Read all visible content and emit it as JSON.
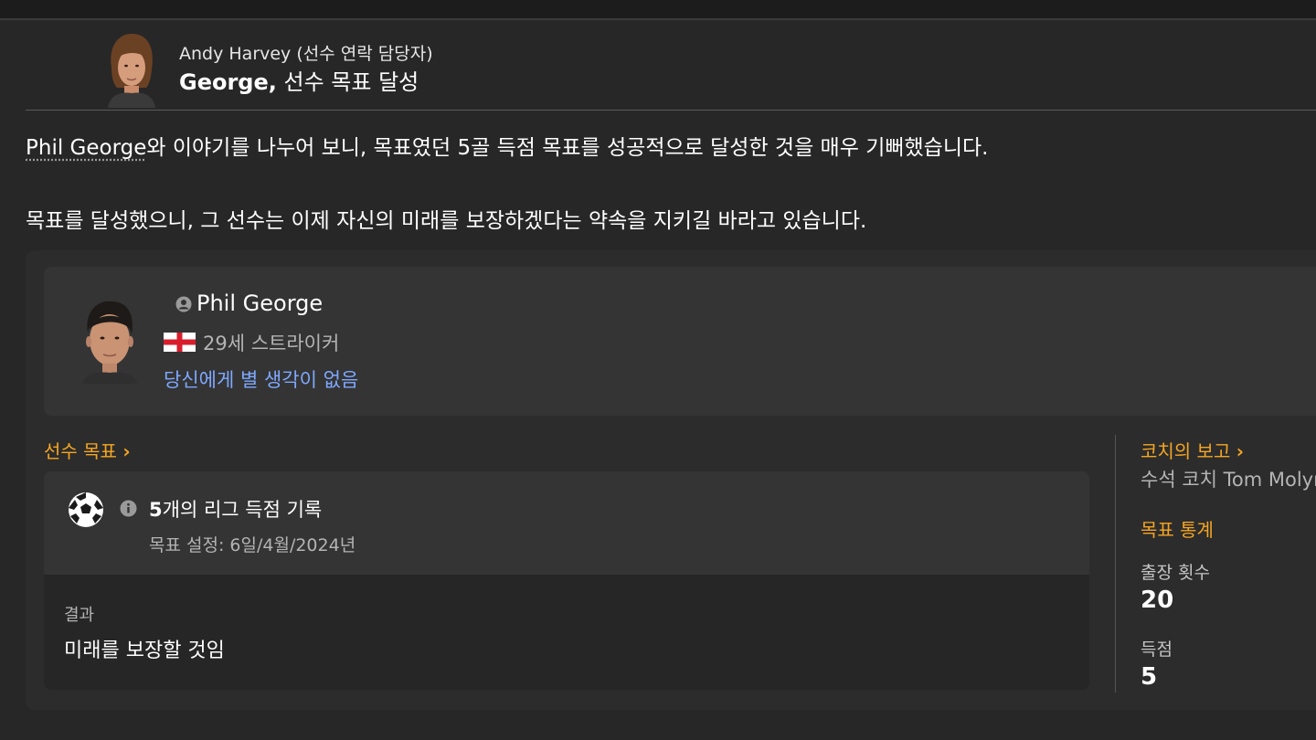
{
  "message": {
    "sender": "Andy Harvey (선수 연락 담당자)",
    "subject_bold": "George,",
    "subject_rest": " 선수 목표 달성",
    "body_player_link": "Phil George",
    "body_line1_rest": "와 이야기를 나누어 보니, 목표였던 5골 득점 목표를 성공적으로 달성한 것을 매우 기뻐했습니다.",
    "body_line2": "목표를 달성했으니, 그 선수는 이제 자신의 미래를 보장하겠다는 약속을 지키길 바라고 있습니다."
  },
  "player": {
    "name": "Phil George",
    "age_position": "29세 스트라이커",
    "nationality_flag": "England",
    "opinion": "당신에게 별 생각이 없음"
  },
  "goals": {
    "section_title": "선수 목표",
    "chevron": "›",
    "goal_count": "5",
    "goal_text": "개의 리그 득점 기록",
    "goal_set": "목표 설정: 6일/4월/2024년",
    "result_label": "결과",
    "result_value": "미래를 보장할 것임"
  },
  "coach": {
    "section_title": "코치의 보고",
    "chevron": "›",
    "text": "수석 코치 Tom Molyneux"
  },
  "stats": {
    "section_title": "목표 통계",
    "appearances_label": "출장 횟수",
    "appearances_value": "20",
    "goals_label": "득점",
    "goals_value": "5"
  },
  "colors": {
    "background": "#272727",
    "card": "#343434",
    "accent_orange": "#f5a623",
    "link_blue": "#7ea8ff"
  }
}
